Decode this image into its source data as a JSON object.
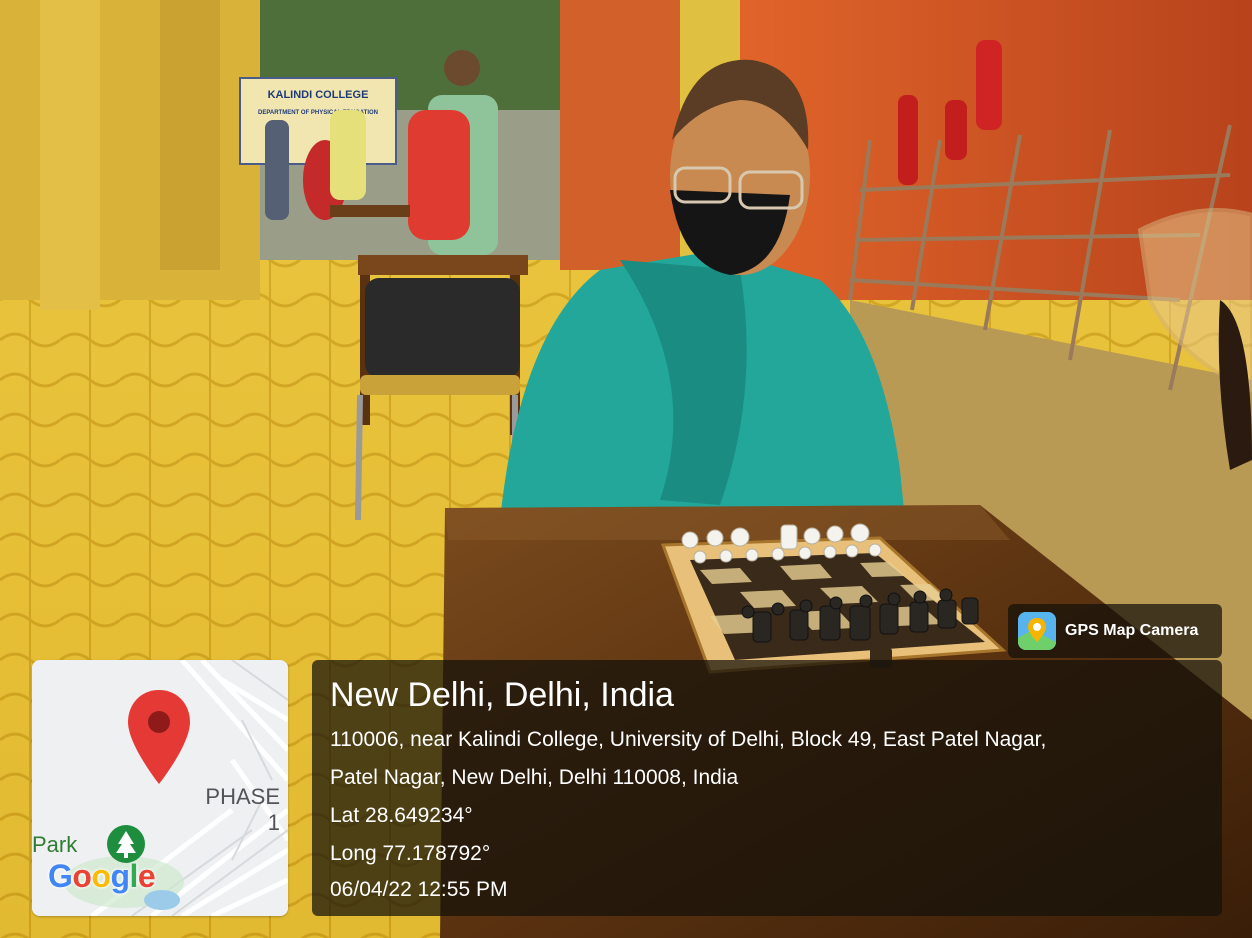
{
  "photo": {
    "banner_college": "KALINDI COLLEGE",
    "banner_dept": "DEPARTMENT OF PHYSICAL EDUCATION"
  },
  "map": {
    "place_label_1": "PHASE",
    "place_label_2": "1",
    "park_label": "Park",
    "logo_text": [
      "G",
      "o",
      "o",
      "g",
      "l",
      "e"
    ],
    "logo_colors": [
      "#4285F4",
      "#EA4335",
      "#FBBC05",
      "#4285F4",
      "#34A853",
      "#EA4335"
    ],
    "marker_color": "#E53935"
  },
  "badge": {
    "label": "GPS Map Camera",
    "icon": "gps-map-camera-icon"
  },
  "info": {
    "title": "New Delhi, Delhi, India",
    "address_line_1": "110006, near Kalindi College, University of Delhi, Block 49, East Patel Nagar,",
    "address_line_2": "Patel Nagar, New Delhi, Delhi 110008, India",
    "lat": "Lat 28.649234°",
    "long": "Long 77.178792°",
    "datetime": "06/04/22 12:55 PM"
  }
}
